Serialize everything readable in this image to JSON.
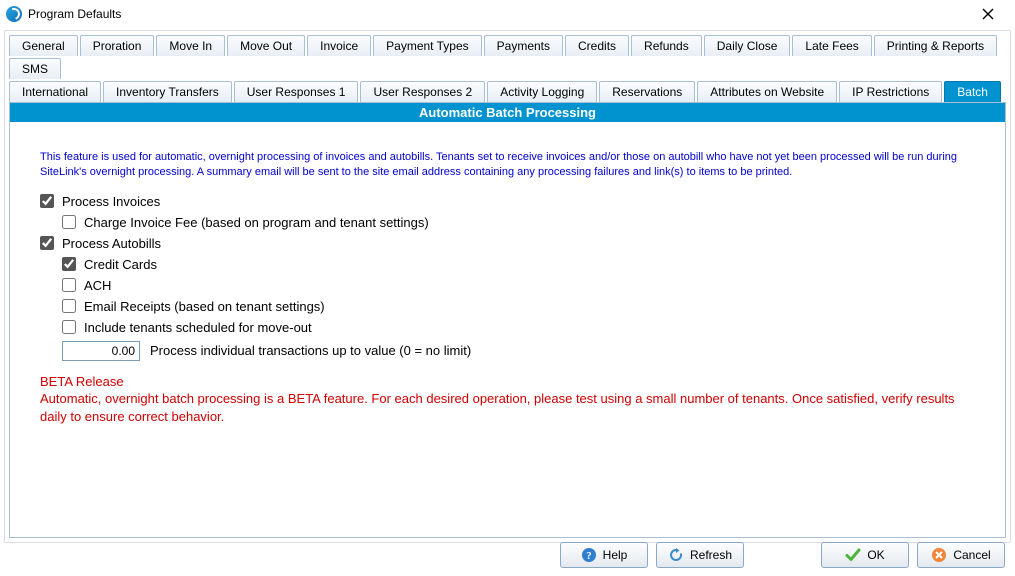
{
  "window": {
    "title": "Program Defaults"
  },
  "tabs": {
    "row1": [
      "General",
      "Proration",
      "Move In",
      "Move Out",
      "Invoice",
      "Payment Types",
      "Payments",
      "Credits",
      "Refunds",
      "Daily Close",
      "Late Fees",
      "Printing & Reports",
      "SMS"
    ],
    "row2": [
      "International",
      "Inventory Transfers",
      "User Responses 1",
      "User Responses 2",
      "Activity Logging",
      "Reservations",
      "Attributes on Website",
      "IP Restrictions",
      "Batch"
    ],
    "active": "Batch"
  },
  "section": {
    "header": "Automatic Batch Processing",
    "intro": "This feature is used for automatic, overnight processing of invoices and autobills. Tenants set to receive invoices and/or those on autobill who have not yet been processed will be run during SiteLink's overnight processing. A summary email will be sent to the site email address containing any processing failures and link(s) to items to be printed.",
    "options": {
      "process_invoices": {
        "label": "Process Invoices",
        "checked": true
      },
      "charge_invoice_fee": {
        "label": "Charge Invoice Fee (based on program and tenant settings)",
        "checked": false
      },
      "process_autobills": {
        "label": "Process Autobills",
        "checked": true
      },
      "credit_cards": {
        "label": "Credit Cards",
        "checked": true
      },
      "ach": {
        "label": "ACH",
        "checked": false
      },
      "email_receipts": {
        "label": "Email Receipts (based on tenant settings)",
        "checked": false
      },
      "include_moveout": {
        "label": "Include tenants scheduled for move-out",
        "checked": false
      },
      "tx_value": {
        "value": "0.00",
        "label": "Process individual transactions up to value (0 = no limit)"
      }
    },
    "beta": {
      "title": "BETA Release",
      "body": "Automatic, overnight batch processing is a BETA feature. For each desired operation, please test using a small number of tenants. Once satisfied, verify results daily to ensure correct behavior."
    }
  },
  "buttons": {
    "help": "Help",
    "refresh": "Refresh",
    "ok": "OK",
    "cancel": "Cancel"
  }
}
